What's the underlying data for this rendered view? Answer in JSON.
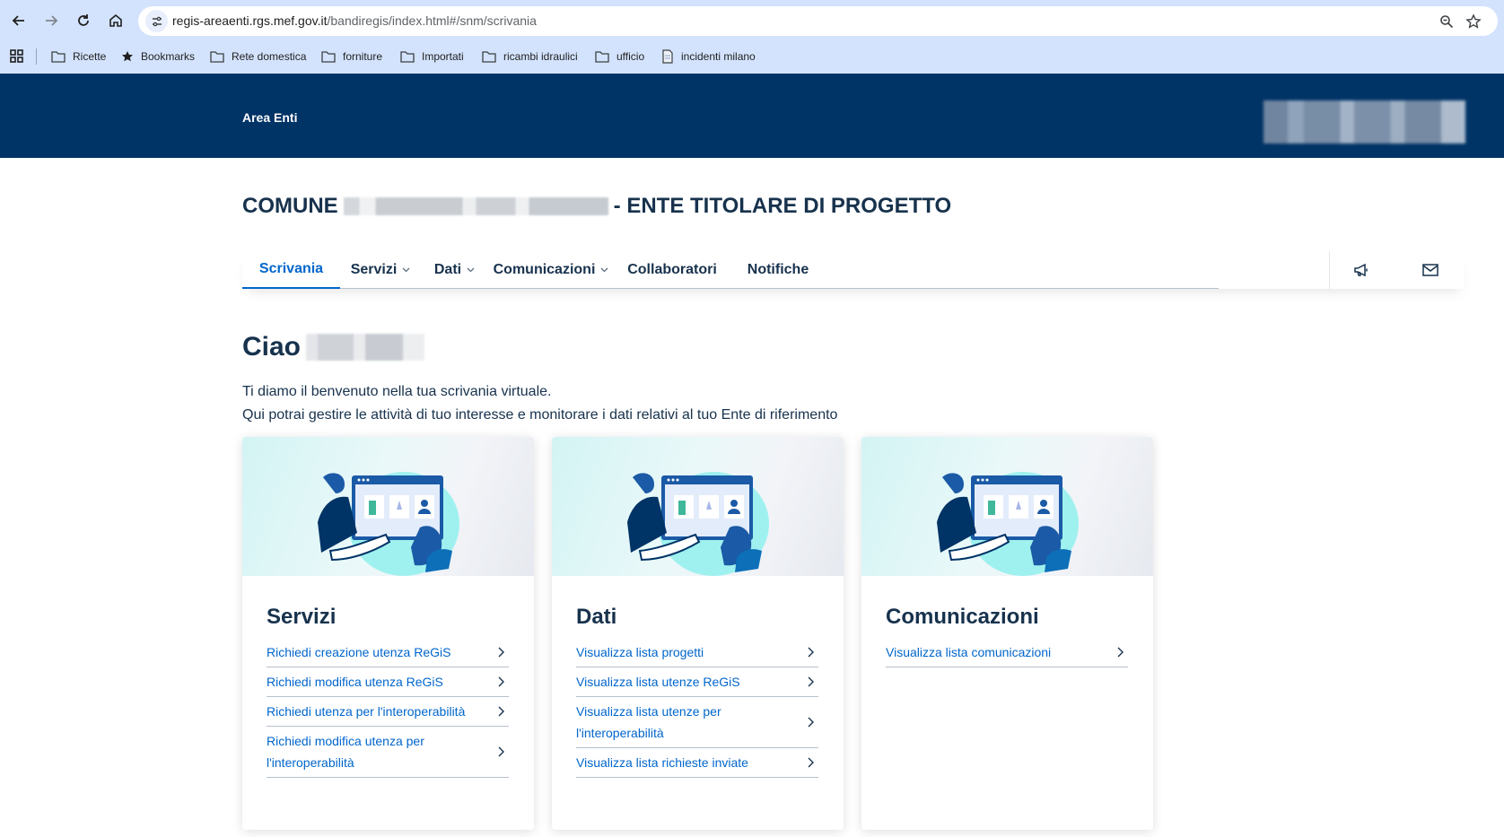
{
  "browser": {
    "url_domain": "regis-areaenti.rgs.mef.gov.it",
    "url_path": "/bandiregis/index.html#/snm/scrivania",
    "bookmarks": [
      "Ricette",
      "Bookmarks",
      "Rete domestica",
      "forniture",
      "Importati",
      "ricambi idraulici",
      "ufficio",
      "incidenti milano"
    ]
  },
  "header": {
    "area_label": "Area Enti"
  },
  "page": {
    "title_prefix": "COMUNE",
    "title_suffix": "- ENTE TITOLARE DI PROGETTO"
  },
  "nav": {
    "tabs": [
      {
        "label": "Scrivania",
        "active": true,
        "dropdown": false
      },
      {
        "label": "Servizi",
        "active": false,
        "dropdown": true
      },
      {
        "label": "Dati",
        "active": false,
        "dropdown": true
      },
      {
        "label": "Comunicazioni",
        "active": false,
        "dropdown": true
      },
      {
        "label": "Collaboratori",
        "active": false,
        "dropdown": false
      },
      {
        "label": "Notifiche",
        "active": false,
        "dropdown": false
      }
    ],
    "icons": [
      "megaphone-icon",
      "mail-icon"
    ]
  },
  "welcome": {
    "greeting": "Ciao",
    "line1": "Ti diamo il benvenuto nella tua scrivania virtuale.",
    "line2": "Qui potrai gestire le attività di tuo interesse e monitorare i dati relativi al tuo Ente di riferimento"
  },
  "cards": [
    {
      "title": "Servizi",
      "links": [
        "Richiedi creazione utenza ReGiS",
        "Richiedi modifica utenza ReGiS",
        "Richiedi utenza per l'interoperabilità",
        "Richiedi modifica utenza per l'interoperabilità"
      ]
    },
    {
      "title": "Dati",
      "links": [
        "Visualizza lista progetti",
        "Visualizza lista utenze ReGiS",
        "Visualizza lista utenze per l'interoperabilità",
        "Visualizza lista richieste inviate"
      ]
    },
    {
      "title": "Comunicazioni",
      "links": [
        "Visualizza lista comunicazioni"
      ]
    }
  ],
  "colors": {
    "header_bg": "#003366",
    "primary": "#0066cc",
    "text_dark": "#17324d"
  }
}
